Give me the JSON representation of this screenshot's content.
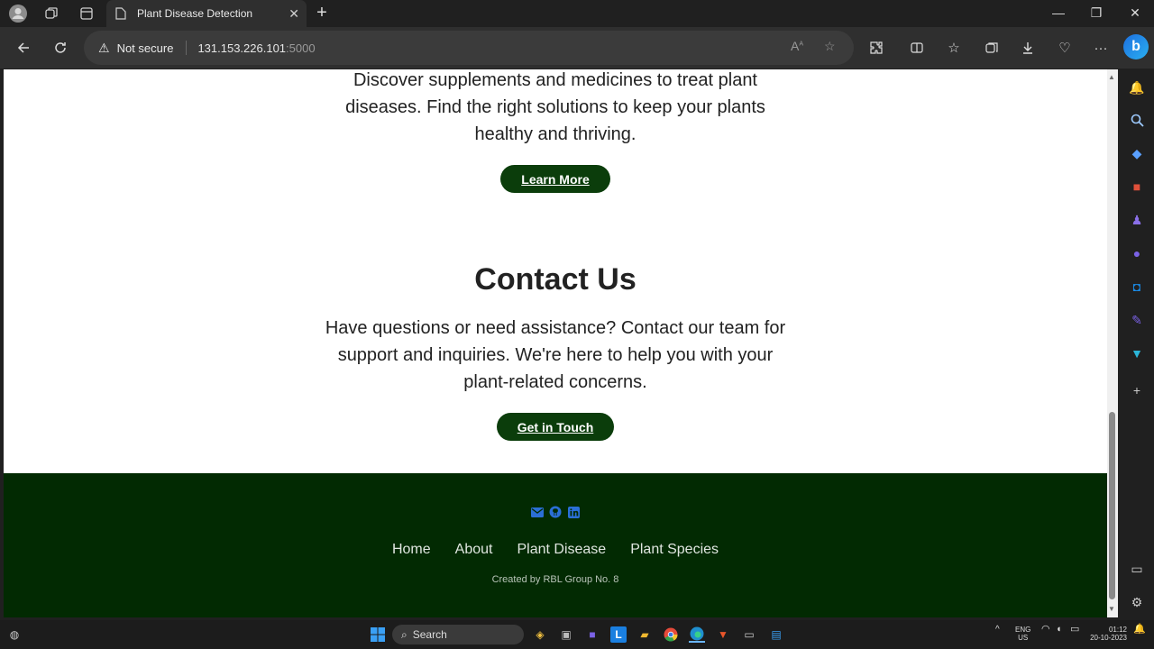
{
  "browser": {
    "tab_title": "Plant Disease Detection",
    "security_label": "Not secure",
    "url_host": "131.153.226.101",
    "url_port": ":5000"
  },
  "page": {
    "supplements_text_line1": "Discover supplements and medicines to treat plant",
    "supplements_text_line2": "diseases. Find the right solutions to keep your plants",
    "supplements_text_line3": "healthy and thriving.",
    "learn_more_label": "Learn More",
    "contact_heading": "Contact Us",
    "contact_text_line1": "Have questions or need assistance? Contact our team for",
    "contact_text_line2": "support and inquiries. We're here to help you with your",
    "contact_text_line3": "plant-related concerns.",
    "contact_button_label": "Get in Touch"
  },
  "footer": {
    "links": [
      "Home",
      "About",
      "Plant Disease",
      "Plant Species"
    ],
    "credit": "Created by RBL Group No. 8",
    "icons": [
      "email-icon",
      "github-icon",
      "linkedin-icon"
    ],
    "bg_color": "#022a02",
    "icon_color": "#2b6fd6"
  },
  "taskbar": {
    "search_label": "Search",
    "lang_top": "ENG",
    "lang_bottom": "US",
    "time": "01:12",
    "date": "20-10-2023"
  },
  "colors": {
    "button_bg": "#0b3d0b",
    "text_dark": "#222222"
  }
}
